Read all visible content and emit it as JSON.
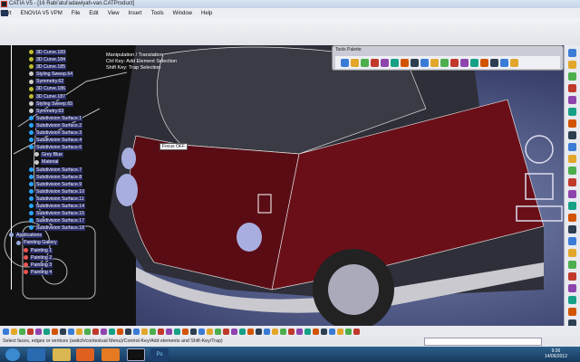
{
  "window": {
    "title": "CATIA V5 - [16 Rabi'atul'adawiyah-van.CATProduct]"
  },
  "menu": [
    "Start",
    "ENOVIA V5 VPM",
    "File",
    "Edit",
    "View",
    "Insert",
    "Tools",
    "Window",
    "Help"
  ],
  "tree": {
    "items": [
      "3D Curve.183",
      "3D Curve.184",
      "3D Curve.185",
      "Styling Sweep.64",
      "Symmetry.62",
      "3D Curve.186",
      "3D Curve.187",
      "Styling Sweep.65",
      "Symmetry.63",
      "Subdivision Surface.1",
      "Subdivision Surface.2",
      "Subdivision Surface.3",
      "Subdivision Surface.4",
      "Subdivision Surface.6",
      "Grey Blue",
      "Material",
      "Subdivision Surface.7",
      "Subdivision Surface.8",
      "Subdivision Surface.9",
      "Subdivision Surface.10",
      "Subdivision Surface.11",
      "Subdivision Surface.14",
      "Subdivision Surface.15",
      "Subdivision Surface.17",
      "Subdivision Surface.18"
    ],
    "applications": "Applications",
    "gallery": "Painting Gallery",
    "paintings": [
      "Painting 1",
      "Painting 2",
      "Painting 3",
      "Painting 4"
    ]
  },
  "overlay": {
    "line1": "Manipulation / Translation",
    "line2": "Ctrl Key: Add Element Selection",
    "line3": "Shift Key: Trap Selection"
  },
  "focus": "Focus OFF",
  "palette": {
    "title": "Tools Palette"
  },
  "status": "Select faces, edges or vertices (switch/contextual Menu)/Control-Key/Add elements and Shift-Key/Trap)",
  "clock": {
    "time": "9:26",
    "date": "14/06/2012"
  },
  "taskbar": {
    "ps": "Ps"
  }
}
